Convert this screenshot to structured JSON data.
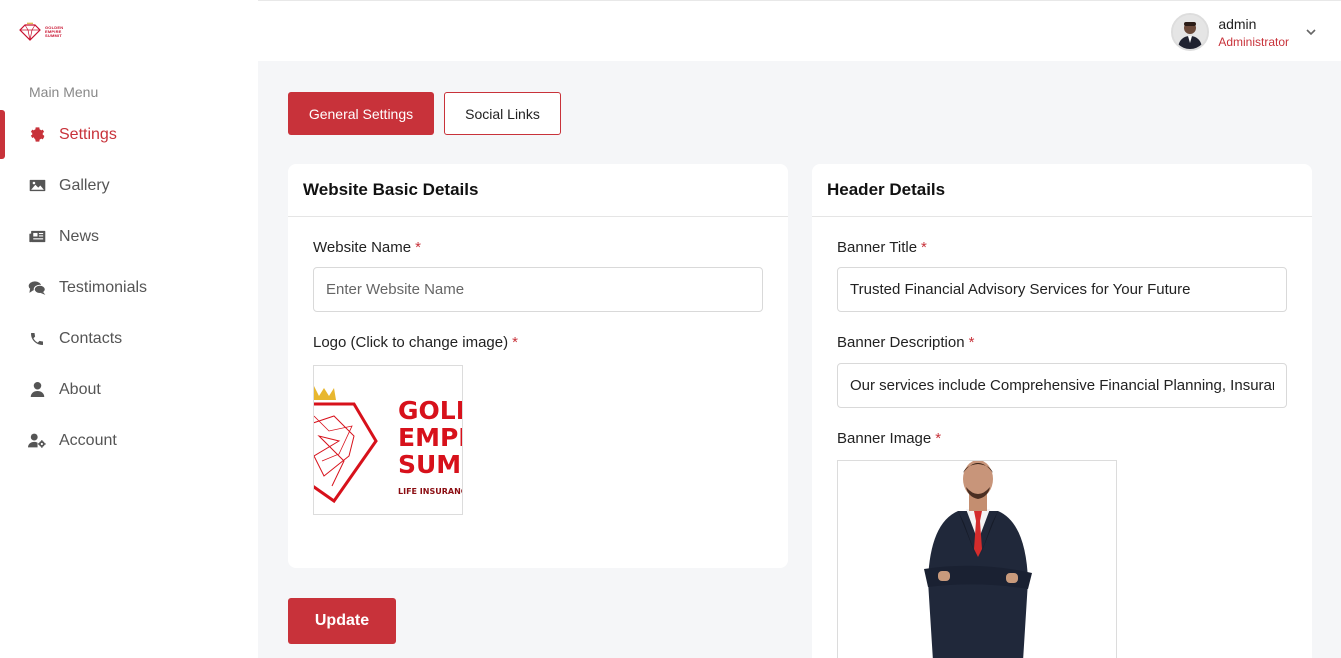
{
  "brand": {
    "lines": [
      "GOLDEN",
      "EMPIRE",
      "SUMMIT"
    ]
  },
  "sidebar": {
    "heading": "Main Menu",
    "items": [
      {
        "label": "Settings",
        "icon": "gear-icon",
        "active": true
      },
      {
        "label": "Gallery",
        "icon": "image-icon",
        "active": false
      },
      {
        "label": "News",
        "icon": "newspaper-icon",
        "active": false
      },
      {
        "label": "Testimonials",
        "icon": "comments-icon",
        "active": false
      },
      {
        "label": "Contacts",
        "icon": "phone-icon",
        "active": false
      },
      {
        "label": "About",
        "icon": "user-icon",
        "active": false
      },
      {
        "label": "Account",
        "icon": "user-cog-icon",
        "active": false
      }
    ]
  },
  "header": {
    "user_name": "admin",
    "user_role": "Administrator"
  },
  "tabs": {
    "general": "General Settings",
    "social": "Social Links"
  },
  "basic": {
    "title": "Website Basic Details",
    "name_label": "Website Name",
    "name_placeholder": "Enter Website Name",
    "name_value": "",
    "logo_label": "Logo (Click to change image)",
    "logo_lines": [
      "GOLDEN",
      "EMPIRE",
      "SUMMIT"
    ],
    "logo_sub": "LIFE INSURANCE"
  },
  "header_details": {
    "title": "Header Details",
    "banner_title_label": "Banner Title",
    "banner_title_value": "Trusted Financial Advisory Services for Your Future",
    "banner_desc_label": "Banner Description",
    "banner_desc_value": "Our services include Comprehensive Financial Planning, Insurance and Investment Advisory",
    "banner_image_label": "Banner Image"
  },
  "required_mark": "*",
  "update_label": "Update",
  "colors": {
    "accent": "#c8323a",
    "sidebar_bg": "#ffffff",
    "page_bg": "#f5f6f8"
  }
}
